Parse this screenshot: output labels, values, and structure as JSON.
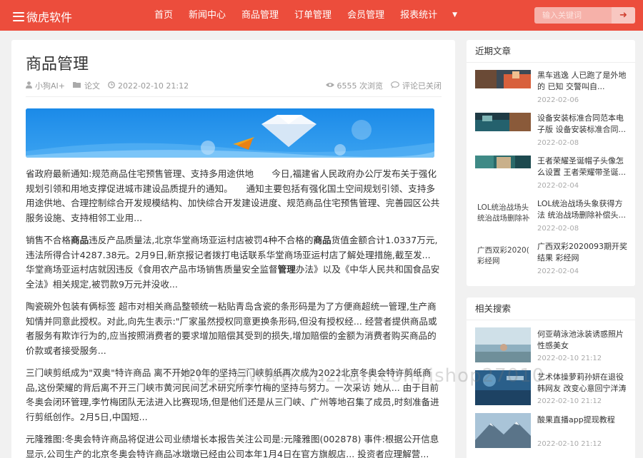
{
  "header": {
    "logo": "微虎软件",
    "nav": [
      "首页",
      "新闻中心",
      "商品管理",
      "订单管理",
      "会员管理",
      "报表统计"
    ],
    "dropdown_icon": "▼",
    "search_placeholder": "输入关键词",
    "search_button": "➜"
  },
  "article": {
    "title": "商品管理",
    "author": "小狗AI+",
    "category": "论文",
    "datetime": "2022-02-10 21:12",
    "views": "6555 次浏览",
    "comments": "评论已关闭",
    "paragraphs": [
      "省政府最新通知:规范商品住宅预售管理、支持多用途供地　　今日,福建省人民政府办公厅发布关于强化规划引领和用地支撑促进城市建设品质提升的通知。　　通知主要包括有强化国土空间规划引领、支持多用途供地、合理控制综合开发规模结构、加快综合开发建设进度、规范商品住宅预售管理、完善园区公共服务设施、支持相邻工业用...",
      "销售不合格",
      "陶瓷碗外包装有俩标签 超市对相关商品整顿统一粘贴青岛含瓷的条形码是为了方便商超统一管理,生产商知情并同意此授权。对此,向先生表示:\"厂家虽然授权同意更换条形码,但没有授权经... 经营者提供商品或者服务有欺诈行为的,应当按照消费者的要求增加赔偿其受到的损失,增加赔偿的金额为消费者购买商品的价款或者接受服务...",
      "三门峡剪纸成为\"双奥\"特许商品 离不开她20年的坚持三门峡剪纸再次成为2022北京冬奥会特许剪纸商品,这份荣耀的背后离不开三门峡市黄河民间艺术研究所李竹梅的坚持与努力。一次采访 她从... 由于目前冬奥会闭环管理,李竹梅团队无法进入比赛现场,但是他们还是从三门峡、广州等地召集了成员,时刻准备进行剪纸创作。2月5日,中国短...",
      "元隆雅图:冬奥会特许商品将促进公司业绩增长本报告关注公司是:元隆雅图(002878) 事件:根据公开信息显示,公司生产的北京冬奥会特许商品冰墩墩已经由公司本年1月4日在官方旗舰店... 投资者应理解营..."
    ],
    "para2_parts": [
      "销售不合格",
      "商品",
      "违反产品质量法,北京华堂商场亚运村店被罚4种不合格的",
      "商品",
      "货值金额合计1.0337万元,违法所得合计4287.38元。2月9日,新京报记者拨打电话联系华堂商场亚运村店了解处理措施,截至发... 华堂商场亚运村店就因违反《食用农产品市场销售质量安全监督",
      "管理",
      "办法》以及《中华人民共和国食品安全法》相关规定,被罚款9万元并没收..."
    ]
  },
  "sidebar": {
    "recent_title": "近期文章",
    "recent": [
      {
        "title": "黑车逃逸 人已跑了是外地的 已知 交警叫自...",
        "date": "2022-02-06"
      },
      {
        "title": "设备安装标准合同范本电子版 设备安装标准合同...",
        "date": "2022-02-08"
      },
      {
        "title": "王者荣耀圣诞帽子头像怎么设置 王者荣耀带圣诞...",
        "date": "2022-02-04"
      },
      {
        "title": "LOL统治战场头象获得方法 统治战场删除补偿头...",
        "date": "2022-02-08",
        "thumb_text": "LOL统治战场头统治战场删除补"
      },
      {
        "title": "广西双彩2020093期开奖结果 彩经网",
        "date": "2022-02-04",
        "thumb_text": "广西双彩2020093期彩经网"
      }
    ],
    "related_title": "相关搜索",
    "related": [
      {
        "title": "何亚萌泳池泳装诱惑照片性感美女",
        "date": "2022-02-10 21:12"
      },
      {
        "title": "艺术体操萝莉孙妍在退役韩网友 改变心意回宁洋涛",
        "date": "2022-02-10 21:12"
      },
      {
        "title": "酸果直播app提现教程",
        "date": "2022-02-10 21:12"
      }
    ]
  },
  "watermark": "https://www.huzhan.com/ishop27010",
  "icons": {
    "menu": "menu-icon",
    "user": "user-icon",
    "folder": "folder-icon",
    "clock": "clock-icon",
    "eye": "eye-icon",
    "comment": "comment-icon"
  },
  "colors": {
    "brand": "#ec4d3c",
    "background": "#f1f1f1",
    "banner": "#1f8ee9"
  }
}
